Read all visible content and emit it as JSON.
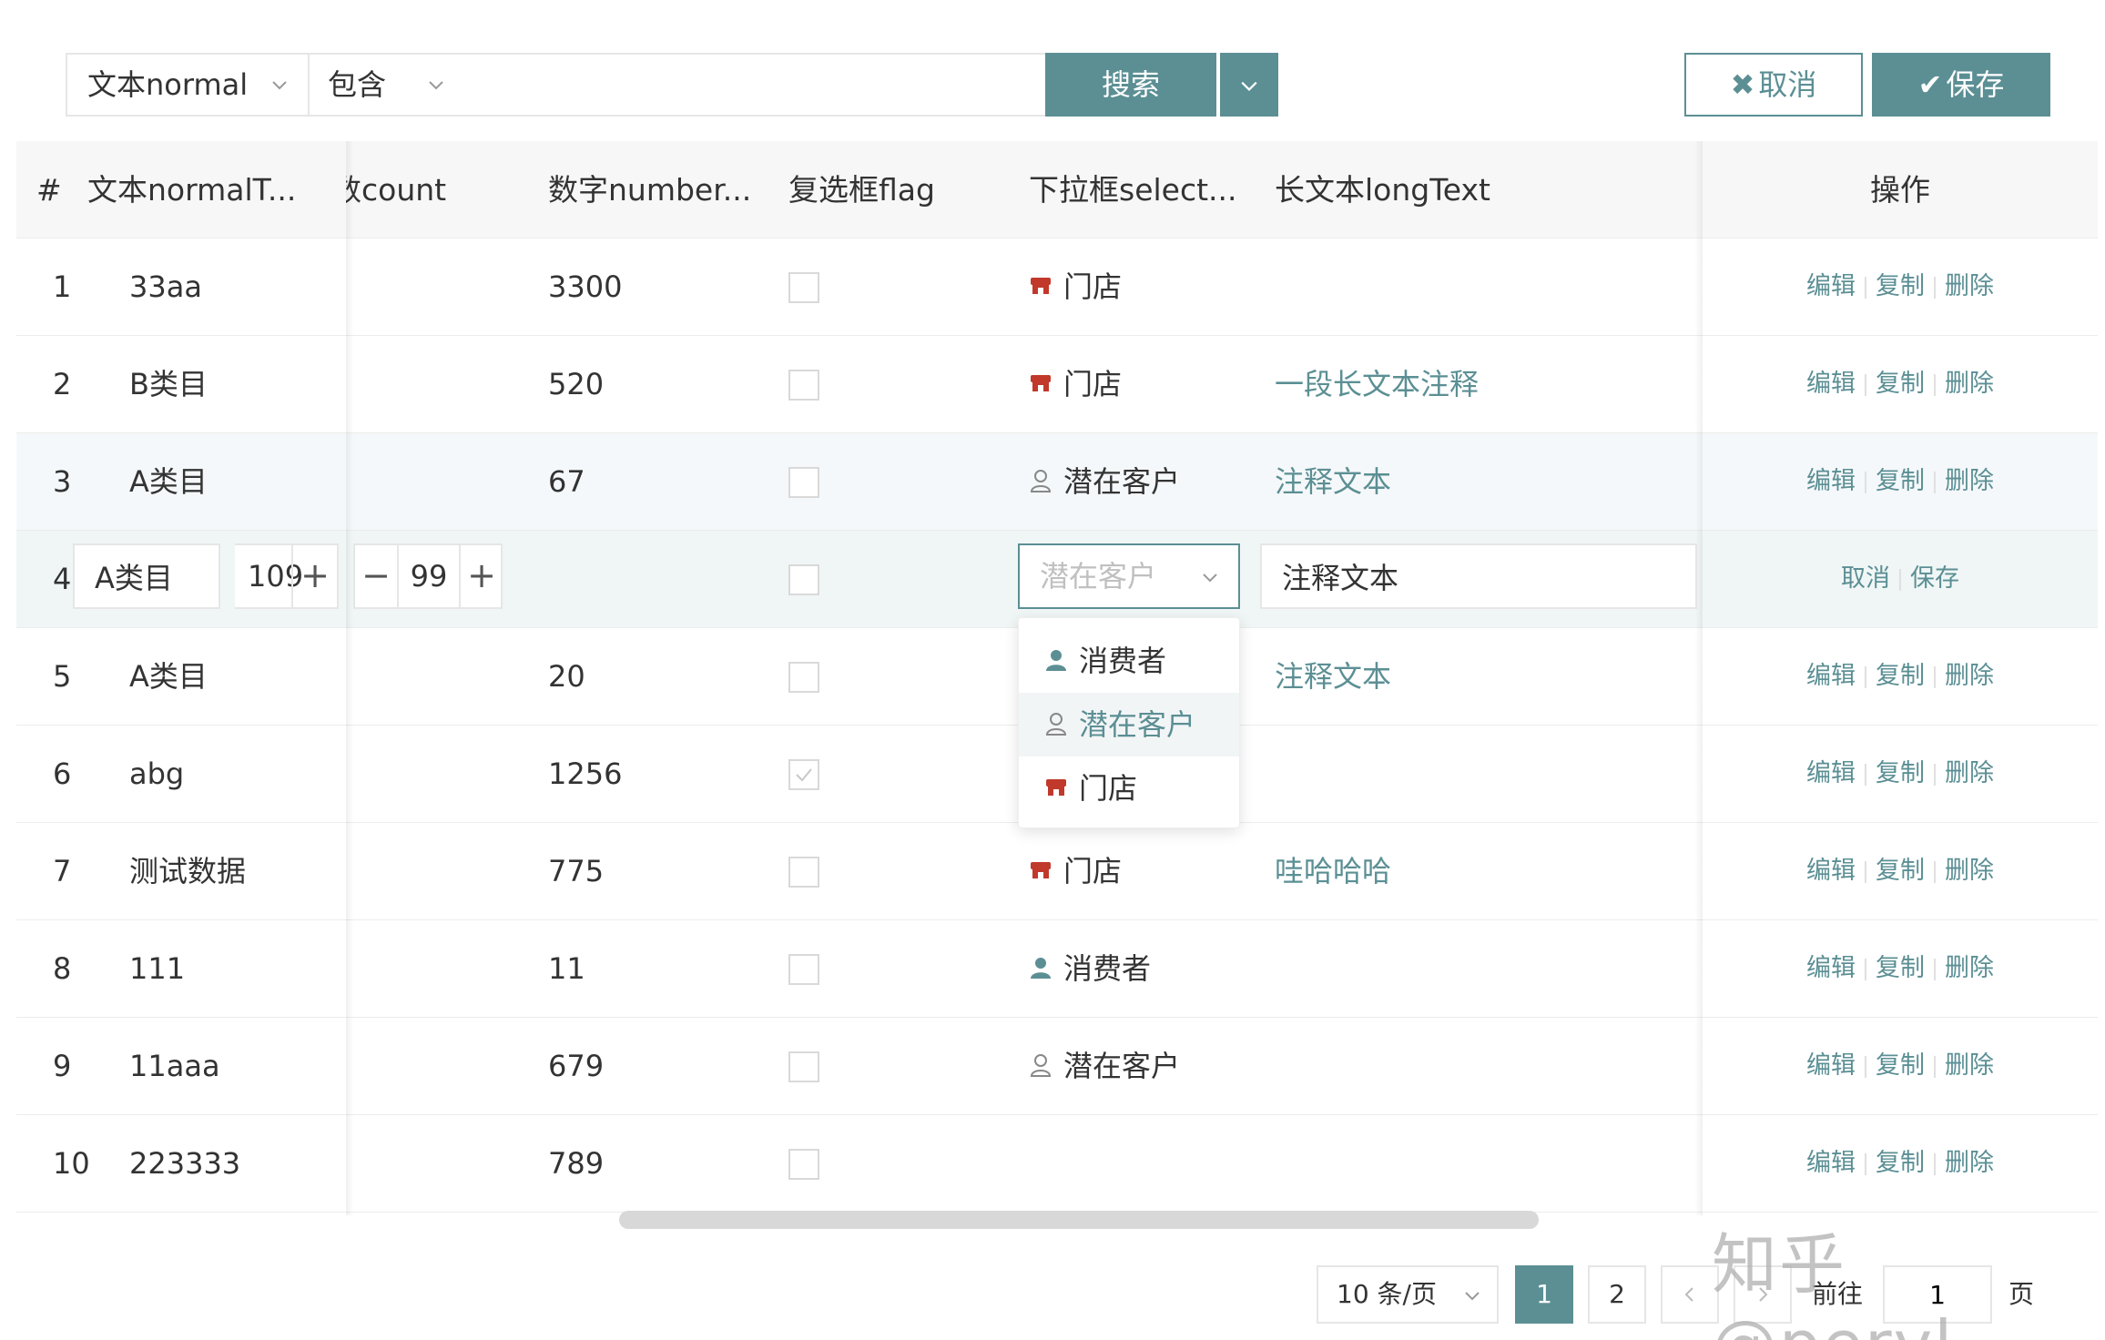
{
  "toolbar": {
    "field_select": "文本normal",
    "operator_select": "包含",
    "search_value": "",
    "search_label": "搜索",
    "cancel_label": "取消",
    "save_label": "保存",
    "cancel_icon": "✖",
    "save_icon": "✔"
  },
  "table": {
    "columns": [
      "#",
      "文本normalT...",
      "数count",
      "数字number...",
      "复选框flag",
      "下拉框select...",
      "长文本longText",
      "操作"
    ],
    "ops": {
      "edit": "编辑",
      "copy": "复制",
      "delete": "删除",
      "cancel": "取消",
      "save": "保存"
    },
    "rows": [
      {
        "idx": "1",
        "text": "33aa",
        "count": "",
        "number": "3300",
        "flag": false,
        "select": "门店",
        "select_icon": "store-icon",
        "long": ""
      },
      {
        "idx": "2",
        "text": "B类目",
        "count": "",
        "number": "520",
        "flag": false,
        "select": "门店",
        "select_icon": "store-icon",
        "long": "一段长文本注释"
      },
      {
        "idx": "3",
        "text": "A类目",
        "count": "",
        "number": "67",
        "flag": false,
        "select": "潜在客户",
        "select_icon": "prospect-icon",
        "long": "注释文本"
      },
      {
        "idx": "4",
        "text": "A类目",
        "count": "109",
        "number": "99",
        "flag": false,
        "select": "潜在客户",
        "select_icon": "prospect-icon",
        "long": "注释文本",
        "editing": true
      },
      {
        "idx": "5",
        "text": "A类目",
        "count": "",
        "number": "20",
        "flag": false,
        "select": "",
        "select_icon": "",
        "long": "注释文本"
      },
      {
        "idx": "6",
        "text": "abg",
        "count": "",
        "number": "1256",
        "flag": true,
        "select": "",
        "select_icon": "",
        "long": ""
      },
      {
        "idx": "7",
        "text": "测试数据",
        "count": "",
        "number": "775",
        "flag": false,
        "select": "门店",
        "select_icon": "store-icon",
        "long": "哇哈哈哈"
      },
      {
        "idx": "8",
        "text": "111",
        "count": "",
        "number": "11",
        "flag": false,
        "select": "消费者",
        "select_icon": "consumer-icon",
        "long": ""
      },
      {
        "idx": "9",
        "text": "11aaa",
        "count": "",
        "number": "679",
        "flag": false,
        "select": "潜在客户",
        "select_icon": "prospect-icon",
        "long": ""
      },
      {
        "idx": "10",
        "text": "223333",
        "count": "",
        "number": "789",
        "flag": false,
        "select": "",
        "select_icon": "",
        "long": ""
      }
    ]
  },
  "edit_row": {
    "text_value": "A类目",
    "count_value": "109",
    "number_value": "99",
    "select_placeholder": "潜在客户",
    "long_value": "注释文本"
  },
  "dropdown": {
    "options": [
      {
        "label": "消费者",
        "icon": "consumer-icon"
      },
      {
        "label": "潜在客户",
        "icon": "prospect-icon",
        "active": true
      },
      {
        "label": "门店",
        "icon": "store-icon"
      }
    ]
  },
  "pagination": {
    "page_size": "10 条/页",
    "pages": [
      "1",
      "2"
    ],
    "current": "1",
    "goto_label": "前往",
    "goto_value": "1",
    "page_suffix": "页"
  },
  "watermark": "知乎 @peryl",
  "colors": {
    "accent": "#5b8f94",
    "store": "#c0392b",
    "consumer": "#5b8f94",
    "prospect": "#888888"
  }
}
